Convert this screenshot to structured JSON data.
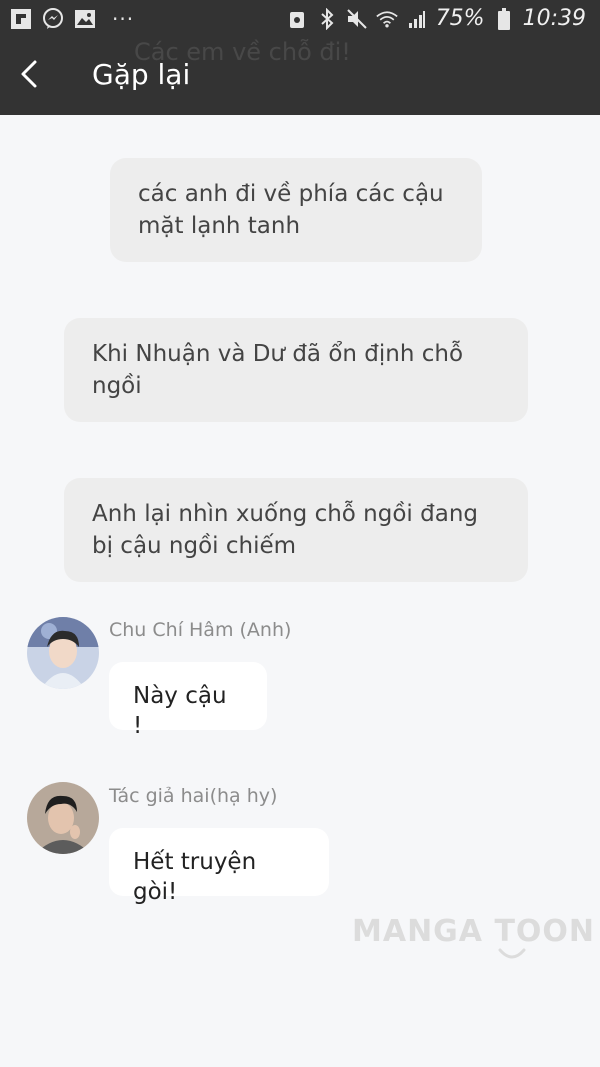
{
  "status_bar": {
    "battery": "75%",
    "time": "10:39",
    "dots": "···"
  },
  "app_bar": {
    "title": "Gặp lại",
    "ghost_text": "Các em về chỗ đi!"
  },
  "narrations": [
    {
      "text": "các anh đi về phía các cậu mặt lạnh tanh"
    },
    {
      "text": "Khi Nhuận và Dư đã ổn định chỗ ngồi"
    },
    {
      "text": "Anh lại nhìn xuống chỗ ngồi đang bị cậu ngồi chiếm"
    }
  ],
  "messages": [
    {
      "sender": "Chu Chí Hâm (Anh)",
      "text": "Này cậu !"
    },
    {
      "sender": "Tác giả hai(hạ hy)",
      "text": "Hết truyện gòi!"
    }
  ],
  "watermark": {
    "text": "MANGA TOON"
  },
  "colors": {
    "app_bar_bg": "#333333",
    "page_bg": "#f6f7f9",
    "narration_bg": "#ededed",
    "bubble_bg": "#ffffff",
    "sender_name": "#8c8c8c"
  },
  "icons": {
    "status_left": [
      "flipboard-icon",
      "messenger-icon",
      "gallery-icon"
    ],
    "status_right": [
      "android-icon",
      "bluetooth-icon",
      "mute-icon",
      "wifi-icon",
      "signal-icon",
      "battery-icon"
    ],
    "app_bar": [
      "back-arrow-icon"
    ]
  }
}
